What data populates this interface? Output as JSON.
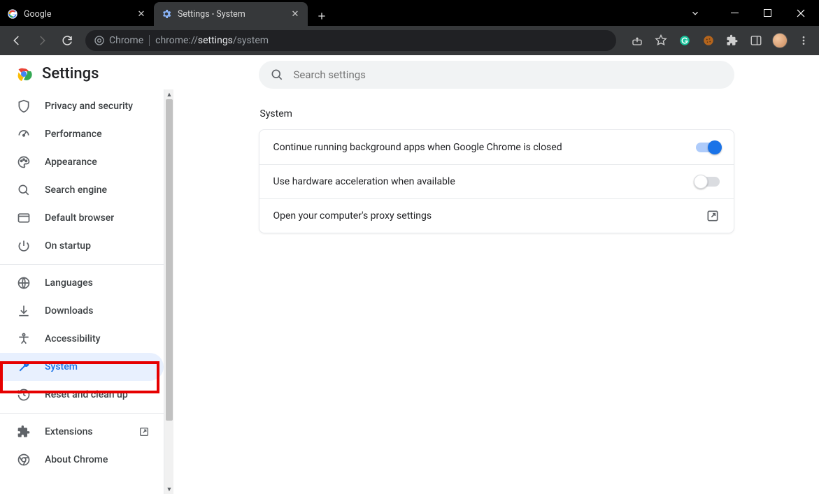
{
  "window": {
    "tabs": [
      {
        "title": "Google",
        "active": false
      },
      {
        "title": "Settings - System",
        "active": true
      }
    ]
  },
  "toolbar": {
    "secure_label": "Chrome",
    "url_prefix": "chrome://",
    "url_bold": "settings",
    "url_suffix": "/system"
  },
  "sidebar": {
    "title": "Settings",
    "groups": [
      {
        "items": [
          {
            "icon": "shield-icon",
            "label": "Privacy and security"
          },
          {
            "icon": "speedometer-icon",
            "label": "Performance"
          },
          {
            "icon": "palette-icon",
            "label": "Appearance"
          },
          {
            "icon": "search-icon",
            "label": "Search engine"
          },
          {
            "icon": "browser-icon",
            "label": "Default browser"
          },
          {
            "icon": "power-icon",
            "label": "On startup"
          }
        ]
      },
      {
        "items": [
          {
            "icon": "globe-icon",
            "label": "Languages"
          },
          {
            "icon": "download-icon",
            "label": "Downloads"
          },
          {
            "icon": "accessibility-icon",
            "label": "Accessibility"
          },
          {
            "icon": "wrench-icon",
            "label": "System",
            "active": true,
            "highlight": true
          },
          {
            "icon": "restore-icon",
            "label": "Reset and clean up"
          }
        ]
      },
      {
        "items": [
          {
            "icon": "puzzle-icon",
            "label": "Extensions",
            "external": true
          },
          {
            "icon": "chrome-outline-icon",
            "label": "About Chrome"
          }
        ]
      }
    ]
  },
  "main": {
    "search_placeholder": "Search settings",
    "section_title": "System",
    "rows": [
      {
        "label": "Continue running background apps when Google Chrome is closed",
        "control": "toggle",
        "on": true
      },
      {
        "label": "Use hardware acceleration when available",
        "control": "toggle",
        "on": false
      },
      {
        "label": "Open your computer's proxy settings",
        "control": "external"
      }
    ]
  }
}
